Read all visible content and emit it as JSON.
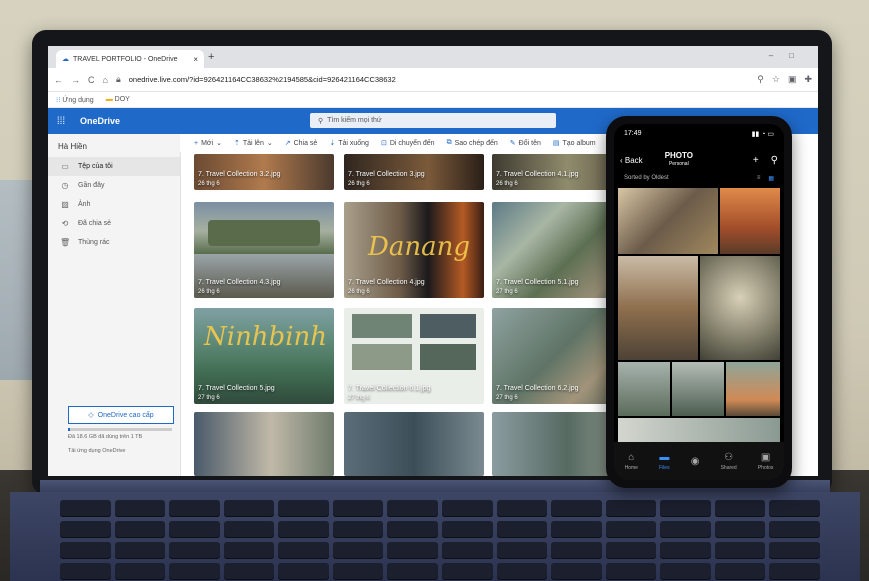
{
  "browser": {
    "tab_title": "TRAVEL PORTFOLIO - OneDrive",
    "url": "onedrive.live.com/?id=926421164CC38632%2194585&cid=926421164CC38632",
    "bookmarks": [
      "Ứng dụng",
      "DOY"
    ]
  },
  "onedrive": {
    "brand": "OneDrive",
    "search_placeholder": "Tìm kiếm mọi thứ",
    "user": "Hà Hiền",
    "nav": [
      "Tệp của tôi",
      "Gần đây",
      "Ảnh",
      "Đã chia sẻ",
      "Thùng rác"
    ],
    "premium_label": "OneDrive cao cấp",
    "storage_text": "Đã 18.6 GB đã dùng trên 1 TB",
    "storage_link": "Tải ứng dụng OneDrive",
    "storage_fraction": 0.02,
    "commands": [
      "Mới",
      "Tải lên",
      "Chia sẻ",
      "Tải xuống",
      "Di chuyển đến",
      "Sao chép đến",
      "Đổi tên",
      "Tạo album"
    ],
    "tiles_row1": [
      {
        "name": "7. Travel Collection 3.2.jpg",
        "date": "26 thg 6"
      },
      {
        "name": "7. Travel Collection 3.jpg",
        "date": "26 thg 6"
      },
      {
        "name": "7. Travel Collection 4.1.jpg",
        "date": "26 thg 6"
      }
    ],
    "tiles_row2": [
      {
        "name": "7. Travel Collection 4.3.jpg",
        "date": "26 thg 6"
      },
      {
        "name": "7. Travel Collection 4.jpg",
        "date": "26 thg 6"
      },
      {
        "name": "7. Travel Collection 5.1.jpg",
        "date": "27 thg 6"
      }
    ],
    "tiles_row3": [
      {
        "name": "7. Travel Collection 5.jpg",
        "date": "27 thg 6"
      },
      {
        "name": "7. Travel Collection 6.1.jpg",
        "date": "27 thg 6"
      },
      {
        "name": "7. Travel Collection 6.2.jpg",
        "date": "27 thg 6"
      }
    ],
    "overlay_words": [
      "Danang",
      "Ninhbinh"
    ]
  },
  "phone": {
    "time": "17:49",
    "back_label": "Back",
    "title": "PHOTO",
    "subtitle": "Personal",
    "sort_label": "Sorted by Oldest",
    "tabs": [
      "Home",
      "Files",
      "",
      "Shared",
      "Photos"
    ]
  }
}
